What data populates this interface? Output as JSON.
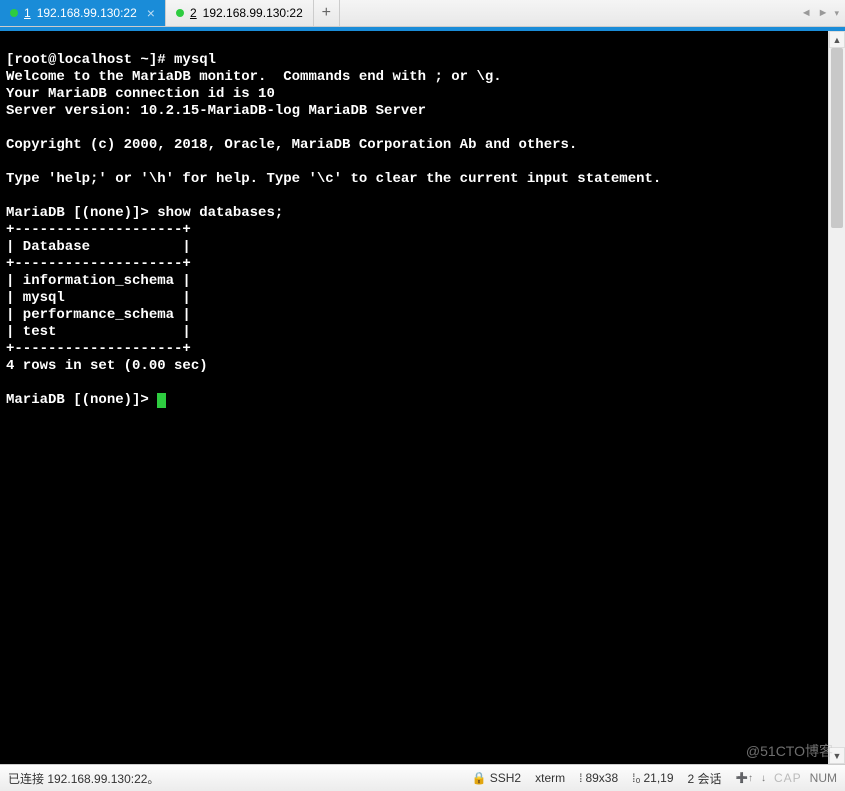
{
  "tabs": [
    {
      "num": "1",
      "title": "192.168.99.130:22",
      "active": true
    },
    {
      "num": "2",
      "title": "192.168.99.130:22",
      "active": false
    }
  ],
  "tab_add": "+",
  "tab_nav": {
    "left": "◄",
    "right": "►",
    "menu": "▾"
  },
  "terminal": {
    "prompt1": "[root@localhost ~]# mysql",
    "welcome1": "Welcome to the MariaDB monitor.  Commands end with ; or \\g.",
    "welcome2": "Your MariaDB connection id is 10",
    "welcome3": "Server version: 10.2.15-MariaDB-log MariaDB Server",
    "blank1": " ",
    "copyright": "Copyright (c) 2000, 2018, Oracle, MariaDB Corporation Ab and others.",
    "blank2": " ",
    "help": "Type 'help;' or '\\h' for help. Type '\\c' to clear the current input statement.",
    "blank3": " ",
    "prompt2": "MariaDB [(none)]> show databases;",
    "sep1": "+--------------------+",
    "hdr": "| Database           |",
    "sep2": "+--------------------+",
    "row1": "| information_schema |",
    "row2": "| mysql              |",
    "row3": "| performance_schema |",
    "row4": "| test               |",
    "sep3": "+--------------------+",
    "rowsmsg": "4 rows in set (0.00 sec)",
    "blank4": " ",
    "prompt3": "MariaDB [(none)]> "
  },
  "status": {
    "connected": "已连接 192.168.99.130:22。",
    "ssh_icon": "🔒",
    "ssh": "SSH2",
    "term": "xterm",
    "size_icon": "⁞",
    "size": "89x38",
    "pos_icon": "⁞₀",
    "pos": "21,19",
    "sessions": "2 会话",
    "cap": "CAP",
    "num": "NUM"
  },
  "scroll": {
    "up": "▲",
    "down": "▼"
  },
  "watermark": "@51CTO博客"
}
